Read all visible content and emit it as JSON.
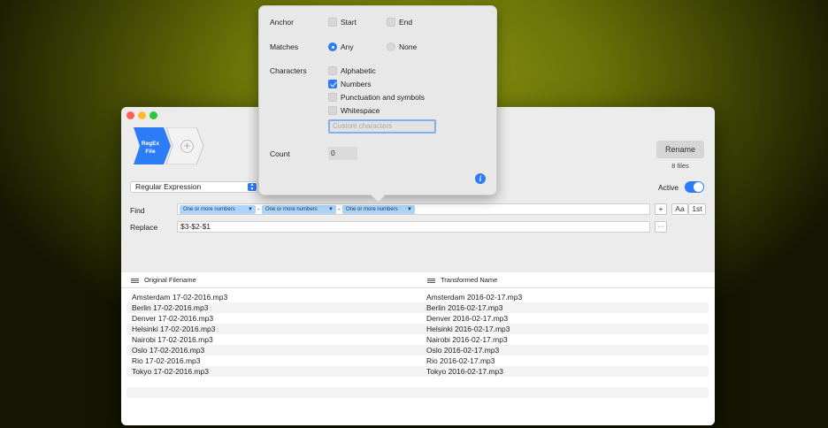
{
  "toolbar": {
    "regex_chevron_title": "RegEx",
    "regex_chevron_subtitle": "File",
    "add_icon": "plus-circle-icon",
    "rename_button": "Rename",
    "files_count": "8 files"
  },
  "mode_select": {
    "value": "Regular Expression"
  },
  "active": {
    "label": "Active",
    "on": true
  },
  "find": {
    "label": "Find",
    "tokens": [
      "One or more numbers",
      "One or more numbers",
      "One or more numbers"
    ],
    "separators": [
      "-",
      "-"
    ],
    "add_button": "+",
    "case_button": "Aa",
    "first_button": "1st"
  },
  "replace": {
    "label": "Replace",
    "value": "$3-$2-$1",
    "more_button": "···"
  },
  "table": {
    "col_original": "Original Filename",
    "col_transformed": "Transformed Name",
    "rows": [
      {
        "original": "Amsterdam 17-02-2016.mp3",
        "transformed": "Amsterdam 2016-02-17.mp3"
      },
      {
        "original": "Berlin 17-02-2016.mp3",
        "transformed": "Berlin 2016-02-17.mp3"
      },
      {
        "original": "Denver 17-02-2016.mp3",
        "transformed": "Denver 2016-02-17.mp3"
      },
      {
        "original": "Helsinki 17-02-2016.mp3",
        "transformed": "Helsinki 2016-02-17.mp3"
      },
      {
        "original": "Nairobi 17-02-2016.mp3",
        "transformed": "Nairobi 2016-02-17.mp3"
      },
      {
        "original": "Oslo 17-02-2016.mp3",
        "transformed": "Oslo 2016-02-17.mp3"
      },
      {
        "original": "Rio 17-02-2016.mp3",
        "transformed": "Rio 2016-02-17.mp3"
      },
      {
        "original": "Tokyo 17-02-2016.mp3",
        "transformed": "Tokyo 2016-02-17.mp3"
      }
    ]
  },
  "popover": {
    "anchor_label": "Anchor",
    "anchor_start": "Start",
    "anchor_end": "End",
    "matches_label": "Matches",
    "matches_any": "Any",
    "matches_none": "None",
    "characters_label": "Characters",
    "alphabetic": "Alphabetic",
    "numbers": "Numbers",
    "punctuation": "Punctuation and symbols",
    "whitespace": "Whitespace",
    "custom_placeholder": "Custom characters",
    "count_label": "Count",
    "count_value": "0",
    "info_icon": "i"
  },
  "colors": {
    "accent": "#2b7cf6",
    "token_bg": "#aed4f7"
  }
}
